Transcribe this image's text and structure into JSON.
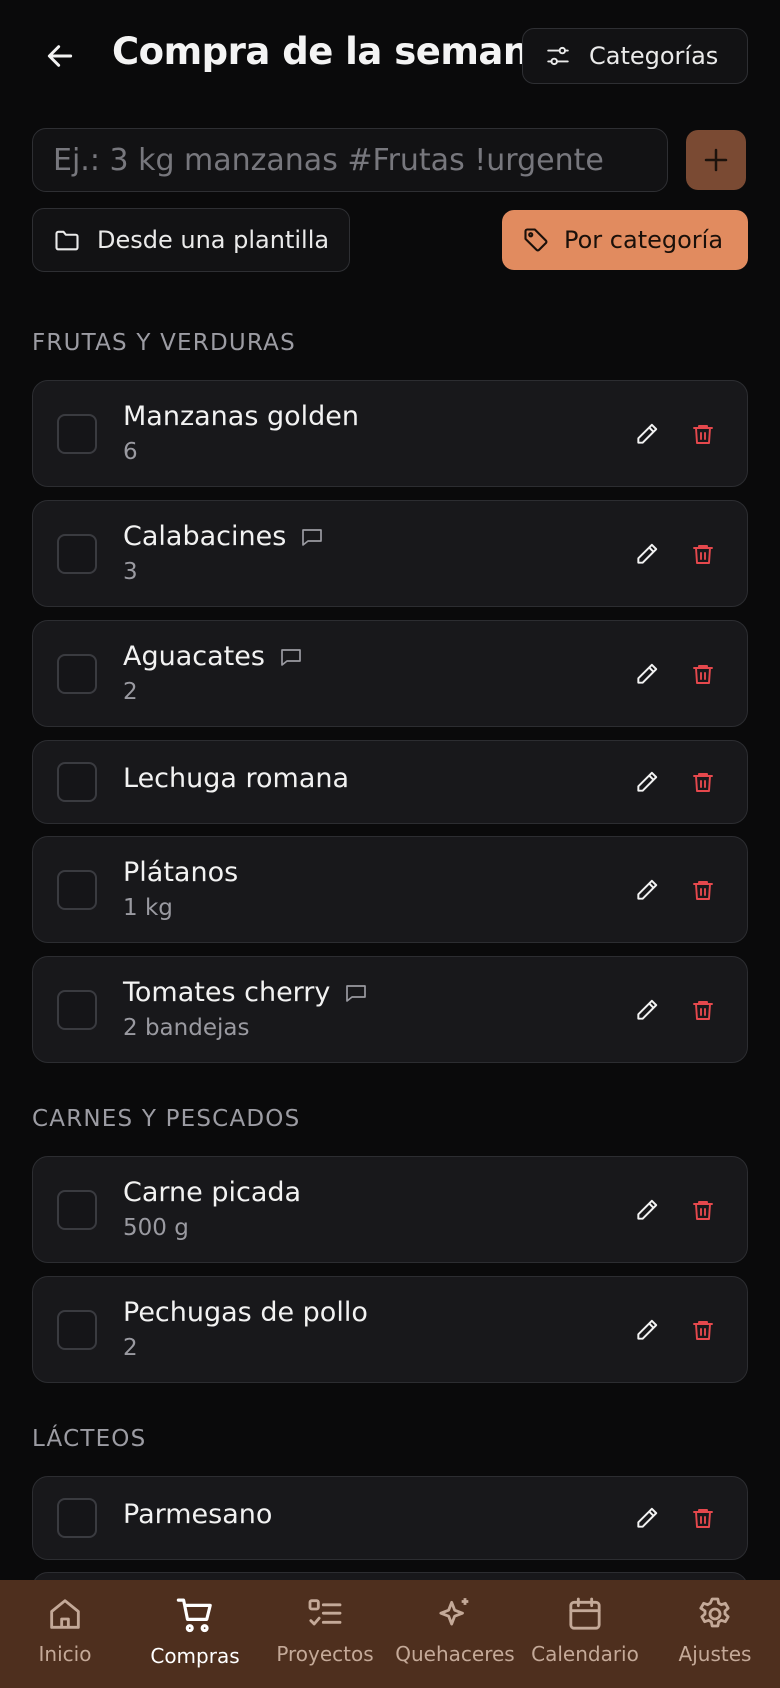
{
  "header": {
    "title": "Compra de la semana",
    "categories_label": "Categorías"
  },
  "add": {
    "placeholder": "Ej.: 3 kg manzanas #Frutas !urgente",
    "value": ""
  },
  "options": {
    "template_label": "Desde una plantilla",
    "by_category_label": "Por categoría"
  },
  "colors": {
    "accent": "#e18b5f",
    "add_button": "#7a4a33",
    "delete": "#e5484d",
    "nav_bg": "#4e2f1e"
  },
  "sections": [
    {
      "title": "FRUTAS Y VERDURAS",
      "items": [
        {
          "name": "Manzanas golden",
          "qty": "6",
          "note": false
        },
        {
          "name": "Calabacines",
          "qty": "3",
          "note": true
        },
        {
          "name": "Aguacates",
          "qty": "2",
          "note": true
        },
        {
          "name": "Lechuga romana",
          "qty": "",
          "note": false
        },
        {
          "name": "Plátanos",
          "qty": "1 kg",
          "note": false
        },
        {
          "name": "Tomates cherry",
          "qty": "2 bandejas",
          "note": true
        }
      ]
    },
    {
      "title": "CARNES Y PESCADOS",
      "items": [
        {
          "name": "Carne picada",
          "qty": "500 g",
          "note": false
        },
        {
          "name": "Pechugas de pollo",
          "qty": "2",
          "note": false
        }
      ]
    },
    {
      "title": "LÁCTEOS",
      "items": [
        {
          "name": "Parmesano",
          "qty": "",
          "note": false
        }
      ]
    }
  ],
  "nav": {
    "active": "Compras",
    "items": [
      {
        "label": "Inicio",
        "icon": "home-icon"
      },
      {
        "label": "Compras",
        "icon": "cart-icon"
      },
      {
        "label": "Proyectos",
        "icon": "checklist-icon"
      },
      {
        "label": "Quehaceres",
        "icon": "sparkles-icon"
      },
      {
        "label": "Calendario",
        "icon": "calendar-icon"
      },
      {
        "label": "Ajustes",
        "icon": "gear-icon"
      }
    ]
  }
}
